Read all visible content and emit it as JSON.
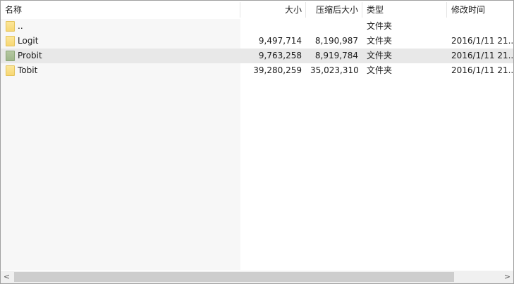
{
  "columns": {
    "name": "名称",
    "size": "大小",
    "packed": "压缩后大小",
    "type": "类型",
    "modified": "修改时间"
  },
  "sort": {
    "column": "name",
    "indicator": "^"
  },
  "rows": [
    {
      "name": "..",
      "size": "",
      "packed": "",
      "type": "文件夹",
      "modified": "",
      "icon": "folder-icon",
      "icon_color": "#f7d774"
    },
    {
      "name": "Logit",
      "size": "9,497,714",
      "packed": "8,190,987",
      "type": "文件夹",
      "modified": "2016/1/11 21...",
      "icon": "folder-icon",
      "icon_color": "#f7d774"
    },
    {
      "name": "Probit",
      "size": "9,763,258",
      "packed": "8,919,784",
      "type": "文件夹",
      "modified": "2016/1/11 21...",
      "icon": "folder-icon",
      "icon_color": "#9fb78b"
    },
    {
      "name": "Tobit",
      "size": "39,280,259",
      "packed": "35,023,310",
      "type": "文件夹",
      "modified": "2016/1/11 21...",
      "icon": "folder-icon",
      "icon_color": "#f7d774"
    }
  ],
  "selected_row": 2,
  "scrollbar": {
    "left_arrow": "<",
    "right_arrow": ">"
  },
  "colors": {
    "selection": "#e8e8e8",
    "sorted_column": "#f7f7f7",
    "folder_yellow": "#f7d774",
    "folder_green": "#9fb78b"
  }
}
